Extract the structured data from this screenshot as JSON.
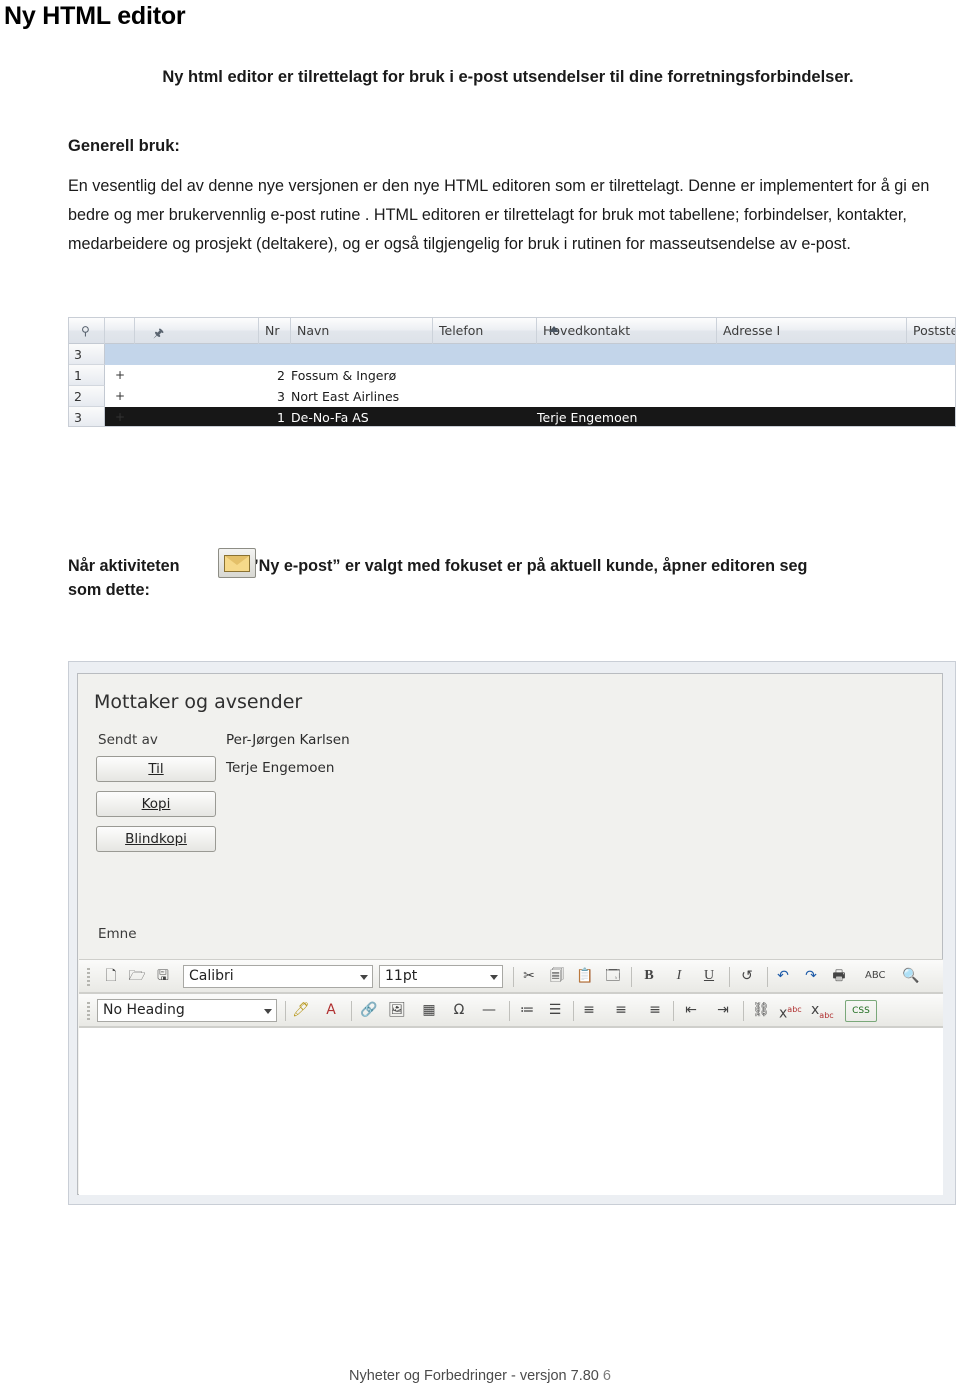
{
  "document": {
    "title": "Ny HTML editor",
    "subtitle": "Ny html editor er tilrettelagt for bruk i e-post utsendelser til dine forretningsforbindelser.",
    "section_heading": "Generell bruk:",
    "paragraph": "En vesentlig del av denne nye versjonen er den nye HTML editoren som er tilrettelagt. Denne er implementert for å gi en bedre og mer brukervennlig e-post rutine .  HTML editoren er tilrettelagt for bruk mot tabellene; forbindelser, kontakter, medarbeidere og prosjekt (deltakere), og er også tilgjengelig for bruk i rutinen for masseutsendelse av e-post.",
    "mid_text_before": "Når aktiviteten",
    "mid_text_after": "”Ny e-post” er valgt med fokuset er på aktuell kunde, åpner editoren seg",
    "mid_text_line2": "som dette:",
    "footer_text": "Nyheter og Forbedringer - versjon 7.80",
    "footer_page": "6"
  },
  "grid_screenshot": {
    "columns": [
      "Nr",
      "Navn",
      "Telefon",
      "Hovedkontakt",
      "Adresse I",
      "Poststed"
    ],
    "rows": [
      {
        "rownum": "3",
        "expand": "",
        "nr": "",
        "navn": "",
        "hovedkontakt": "",
        "state": "selected-blue"
      },
      {
        "rownum": "1",
        "expand": "+",
        "nr": "2",
        "navn": "Fossum & Ingerø",
        "hovedkontakt": "",
        "state": "white"
      },
      {
        "rownum": "2",
        "expand": "+",
        "nr": "3",
        "navn": "Nort East Airlines",
        "hovedkontakt": "",
        "state": "white"
      },
      {
        "rownum": "3",
        "expand": "+",
        "nr": "1",
        "navn": "De-No-Fa AS",
        "hovedkontakt": "Terje Engemoen",
        "state": "selected-dark"
      }
    ]
  },
  "editor_screenshot": {
    "title": "Mottaker og avsender",
    "sent_by_label": "Sendt av",
    "sent_by_value": "Per-Jørgen Karlsen",
    "to_button": "Til",
    "to_value": "Terje Engemoen",
    "copy_button": "Kopi",
    "blind_copy_button": "Blindkopi",
    "subject_label": "Emne",
    "toolbar": {
      "font_family": "Calibri",
      "font_size": "11pt",
      "heading_style": "No Heading",
      "row1_icons": [
        "new-document-icon",
        "open-folder-icon",
        "save-icon",
        "cut-scissors-icon",
        "copy-icon",
        "paste-icon",
        "paste-special-icon",
        "bold-icon",
        "italic-icon",
        "underline-icon",
        "clear-formatting-icon",
        "undo-icon",
        "redo-icon",
        "print-icon",
        "spellcheck-icon",
        "find-replace-icon"
      ],
      "row2_icons": [
        "highlighter-icon",
        "text-color-icon",
        "insert-link-icon",
        "insert-image-icon",
        "insert-table-icon",
        "special-character-icon",
        "horizontal-rule-icon",
        "numbered-list-icon",
        "bulleted-list-icon",
        "align-left-icon",
        "align-center-icon",
        "align-right-icon",
        "decrease-indent-icon",
        "increase-indent-icon",
        "remove-link-icon",
        "superscript-icon",
        "subscript-icon",
        "css-icon"
      ],
      "bold_label": "B",
      "italic_label": "I",
      "underline_label": "U",
      "spellcheck_label": "ABC",
      "css_label": "CSS",
      "superscript_label": "x",
      "subscript_label": "x"
    }
  },
  "colors": {
    "selection_blue": "#c3d5ea",
    "selection_dark": "#171717",
    "page_bg": "#ffffff",
    "chrome_gray": "#eceff3"
  }
}
